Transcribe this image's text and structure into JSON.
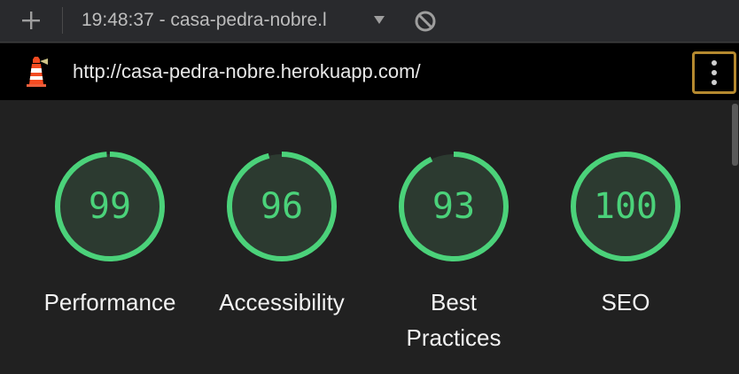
{
  "toolbar": {
    "title": "19:48:37 - casa-pedra-nobre.l",
    "plus_icon": "plus-icon",
    "dropdown_icon": "chevron-down-icon",
    "block_icon": "block-icon"
  },
  "urlbar": {
    "url": "http://casa-pedra-nobre.herokuapp.com/",
    "logo_icon": "lighthouse-icon",
    "menu_icon": "kebab-menu-icon"
  },
  "colors": {
    "pass": "#4bd27a",
    "gauge_bg": "#2c3a30",
    "menu_border": "#b5892f"
  },
  "gauges": [
    {
      "score": 99,
      "label": "Performance"
    },
    {
      "score": 96,
      "label": "Accessibility"
    },
    {
      "score": 93,
      "label": "Best Practices"
    },
    {
      "score": 100,
      "label": "SEO"
    }
  ]
}
